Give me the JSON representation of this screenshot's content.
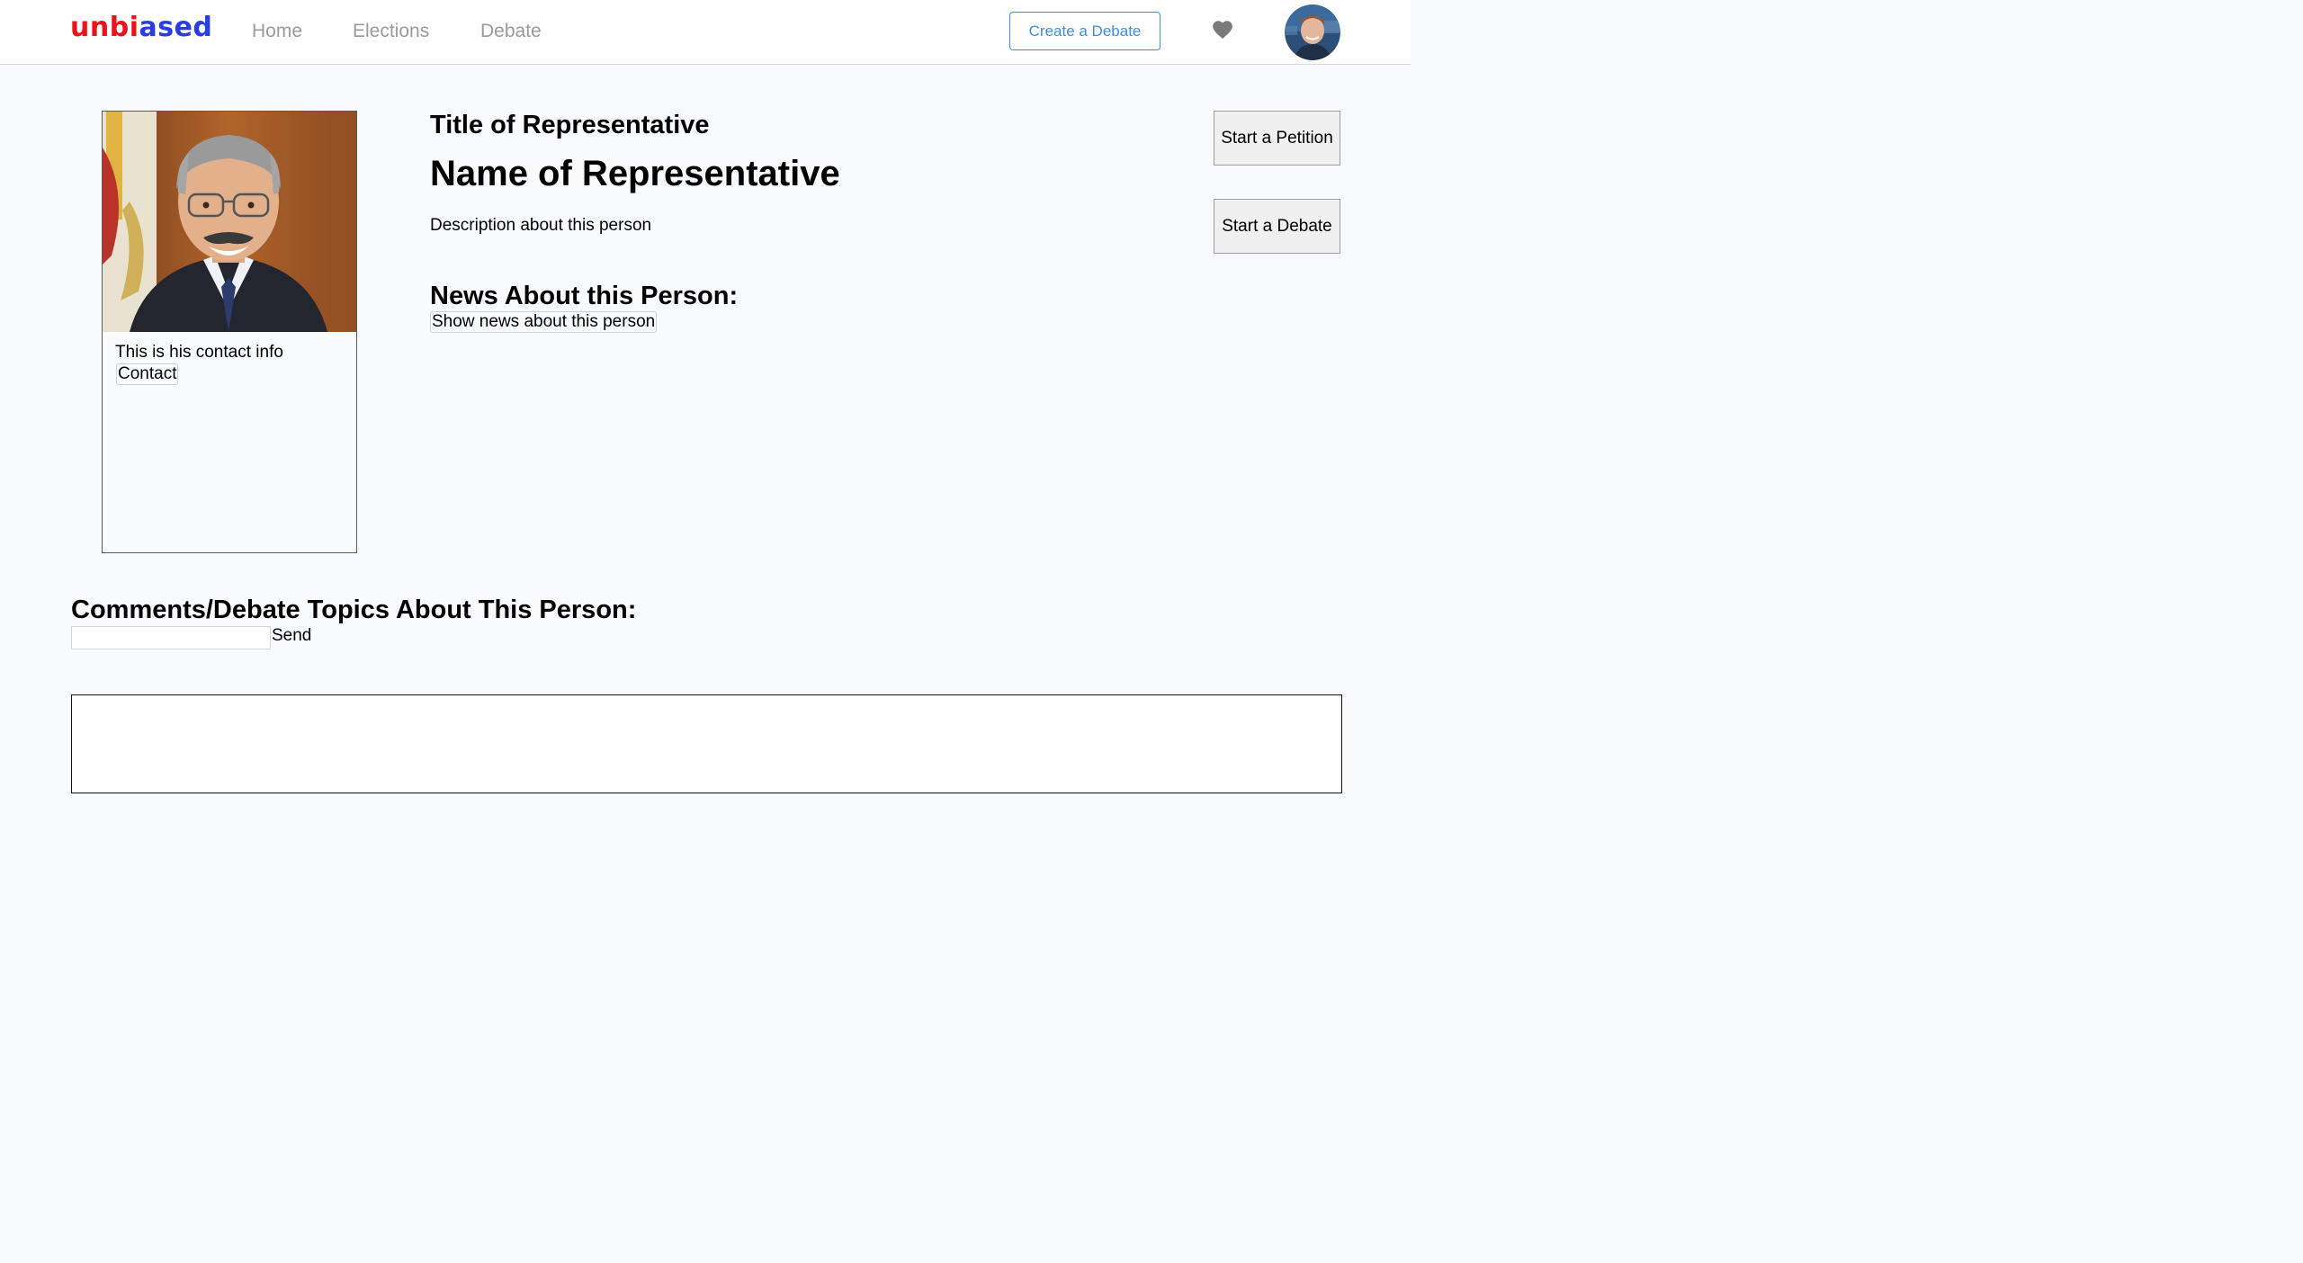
{
  "navbar": {
    "logo_part_a": "unbi",
    "logo_part_b": "ased",
    "links": [
      "Home",
      "Elections",
      "Debate"
    ],
    "create_button": "Create a Debate",
    "heart_icon": "heart-icon",
    "avatar_icon": "user-avatar"
  },
  "profile": {
    "contact_text": "This is his contact info",
    "contact_button": "Contact"
  },
  "representative": {
    "title": "Title of Representative",
    "name": "Name of Representative",
    "description": "Description about this person"
  },
  "news": {
    "heading": "News About this Person:",
    "button": "Show news about this person"
  },
  "actions": {
    "petition": "Start a Petition",
    "debate": "Start a Debate"
  },
  "comments": {
    "heading": "Comments/Debate Topics About This Person:",
    "input_value": "",
    "send": "Send"
  },
  "colors": {
    "logo_red": "#e8141c",
    "logo_blue": "#2a3de0",
    "accent_blue": "#3d8ee6",
    "page_bg": "#f9fafc"
  }
}
